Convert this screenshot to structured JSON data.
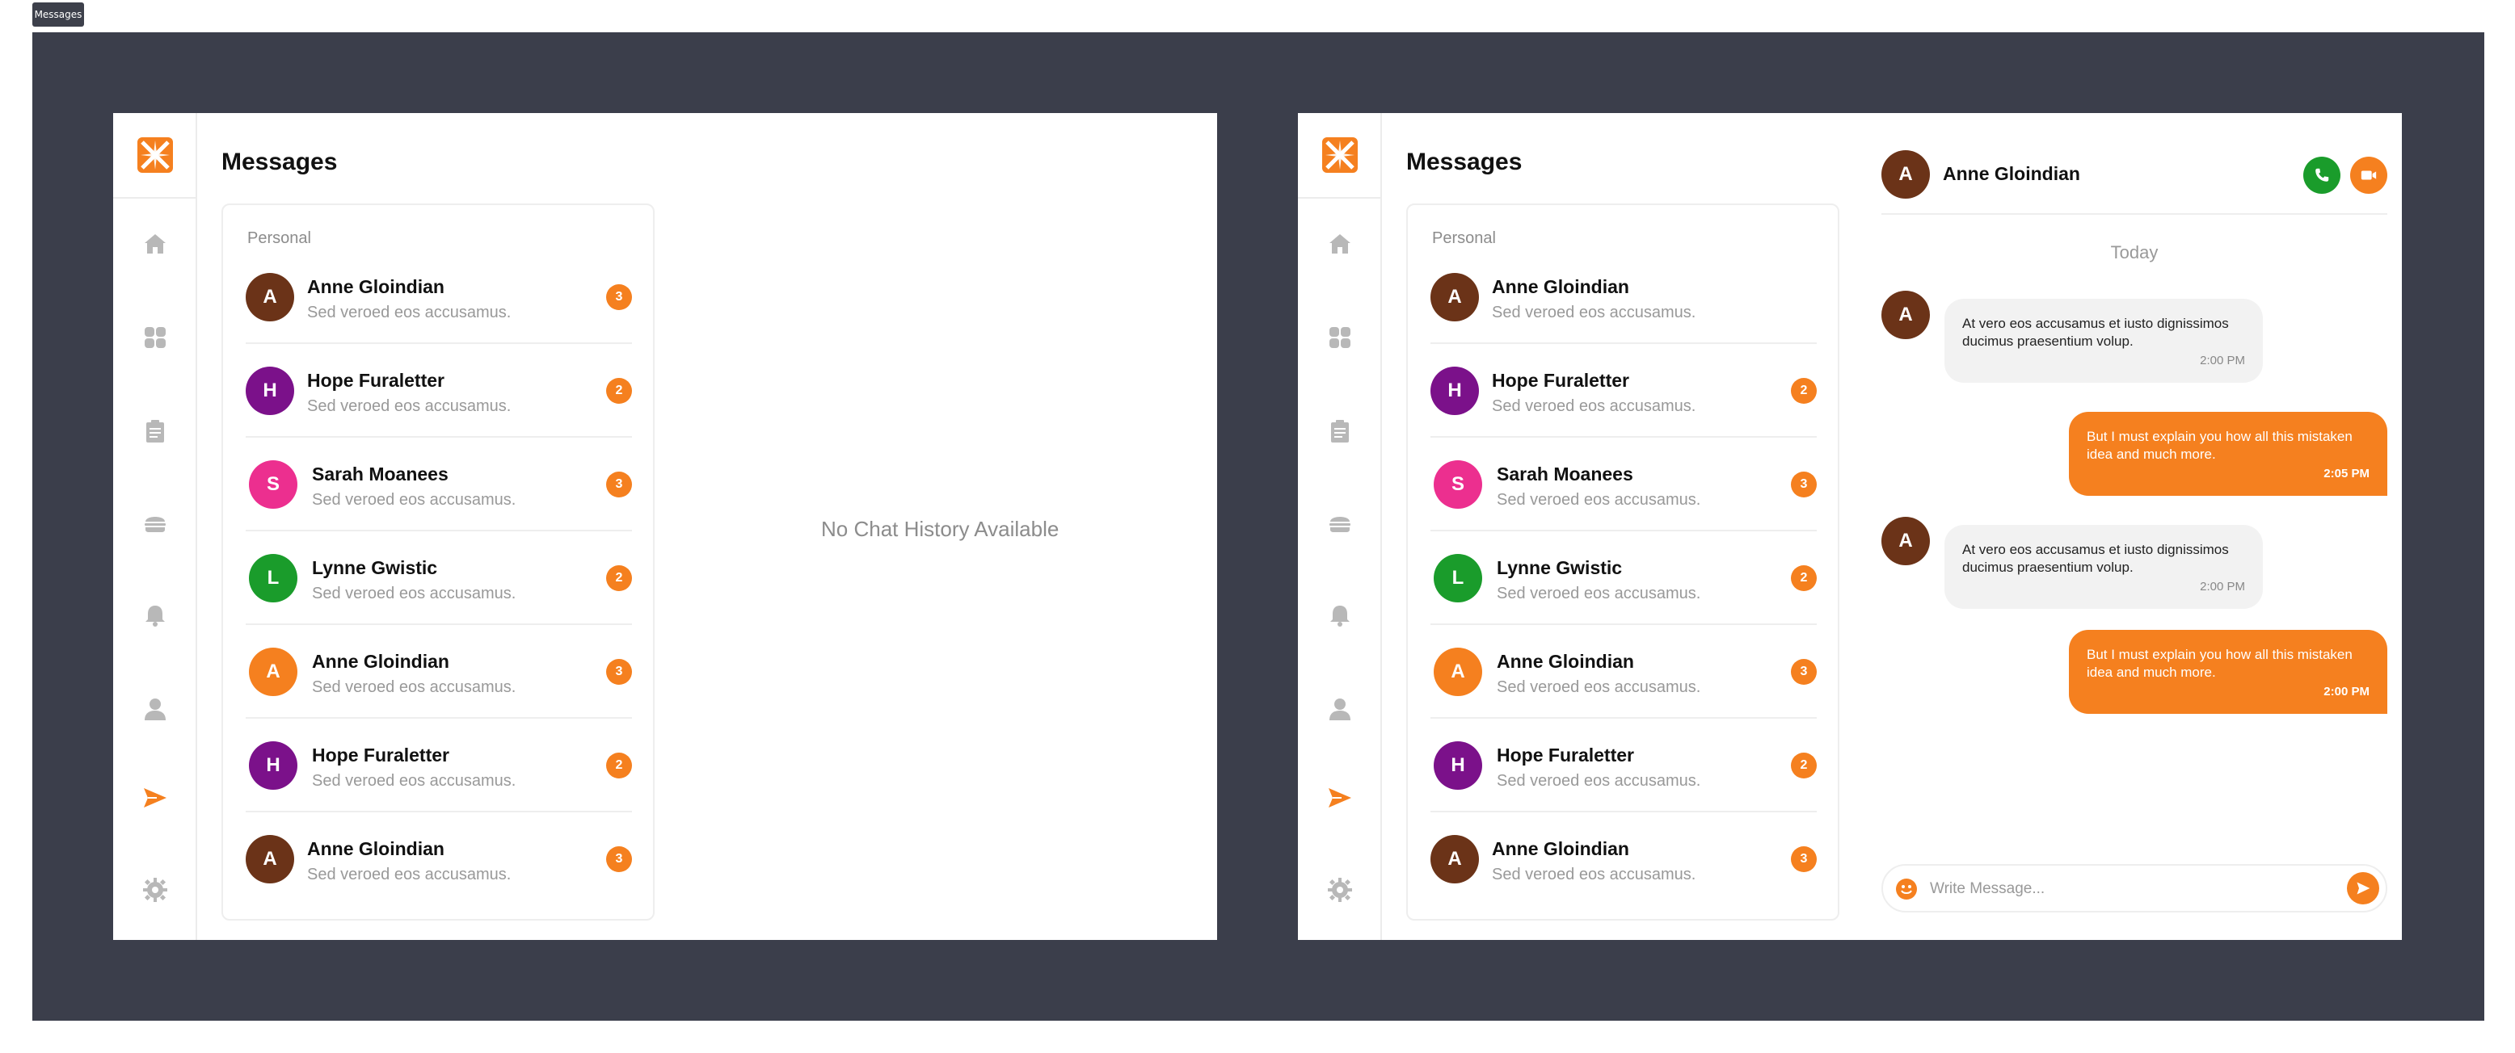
{
  "badge_label": "Messages",
  "colors": {
    "accent": "#f5801f",
    "canvas": "#3b3e4b",
    "green": "#1a9c2b",
    "nav_gray": "#b8b8b8"
  },
  "nav": [
    "home-icon",
    "dashboard-icon",
    "clipboard-icon",
    "burger-icon",
    "bell-icon",
    "user-icon",
    "send-icon",
    "gear-icon"
  ],
  "left": {
    "title": "Messages",
    "list_heading": "Personal",
    "contacts": [
      {
        "initial": "A",
        "name": "Anne Gloindian",
        "preview": "Sed veroed eos accusamus.",
        "unread": "3",
        "color": "#6b3318"
      },
      {
        "initial": "H",
        "name": "Hope Furaletter",
        "preview": "Sed veroed eos accusamus.",
        "unread": "2",
        "color": "#7b118a"
      },
      {
        "initial": "S",
        "name": "Sarah Moanees",
        "preview": "Sed veroed eos accusamus.",
        "unread": "3",
        "color": "#ec2f8f"
      },
      {
        "initial": "L",
        "name": "Lynne Gwistic",
        "preview": "Sed veroed eos accusamus.",
        "unread": "2",
        "color": "#1a9c2b"
      },
      {
        "initial": "A",
        "name": "Anne Gloindian",
        "preview": "Sed veroed eos accusamus.",
        "unread": "3",
        "color": "#f5801f"
      },
      {
        "initial": "H",
        "name": "Hope Furaletter",
        "preview": "Sed veroed eos accusamus.",
        "unread": "2",
        "color": "#7b118a"
      },
      {
        "initial": "A",
        "name": "Anne Gloindian",
        "preview": "Sed veroed eos accusamus.",
        "unread": "3",
        "color": "#6b3318"
      }
    ],
    "empty_state": "No Chat History Available"
  },
  "right": {
    "title": "Messages",
    "list_heading": "Personal",
    "contacts": [
      {
        "initial": "A",
        "name": "Anne Gloindian",
        "preview": "Sed veroed eos accusamus.",
        "unread": "",
        "color": "#6b3318"
      },
      {
        "initial": "H",
        "name": "Hope Furaletter",
        "preview": "Sed veroed eos accusamus.",
        "unread": "2",
        "color": "#7b118a"
      },
      {
        "initial": "S",
        "name": "Sarah Moanees",
        "preview": "Sed veroed eos accusamus.",
        "unread": "3",
        "color": "#ec2f8f"
      },
      {
        "initial": "L",
        "name": "Lynne Gwistic",
        "preview": "Sed veroed eos accusamus.",
        "unread": "2",
        "color": "#1a9c2b"
      },
      {
        "initial": "A",
        "name": "Anne Gloindian",
        "preview": "Sed veroed eos accusamus.",
        "unread": "3",
        "color": "#f5801f"
      },
      {
        "initial": "H",
        "name": "Hope Furaletter",
        "preview": "Sed veroed eos accusamus.",
        "unread": "2",
        "color": "#7b118a"
      },
      {
        "initial": "A",
        "name": "Anne Gloindian",
        "preview": "Sed veroed eos accusamus.",
        "unread": "3",
        "color": "#6b3318"
      }
    ],
    "chat": {
      "contact_initial": "A",
      "contact_name": "Anne Gloindian",
      "day_separator": "Today",
      "messages": [
        {
          "direction": "in",
          "text": "At vero eos accusamus et iusto dignissimos ducimus praesentium volup.",
          "time": "2:00 PM"
        },
        {
          "direction": "out",
          "text": "But I must explain you how all this mistaken idea and much more.",
          "time": "2:05 PM"
        },
        {
          "direction": "in",
          "text": "At vero eos accusamus et iusto dignissimos ducimus praesentium volup.",
          "time": "2:00 PM"
        },
        {
          "direction": "out",
          "text": "But I must explain you how all  this mistaken idea and much more.",
          "time": "2:00 PM"
        }
      ],
      "composer_placeholder": "Write Message..."
    }
  }
}
